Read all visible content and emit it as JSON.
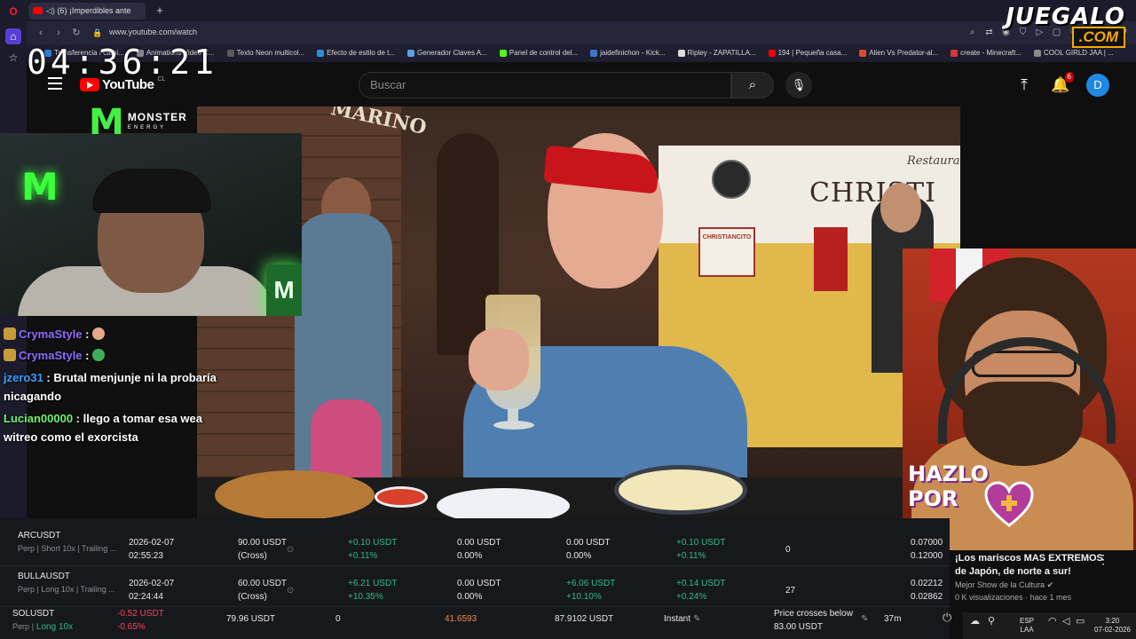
{
  "browser": {
    "tab_title": "(6) ¡Imperdibles ante",
    "url": "www.youtube.com/watch",
    "bookmarks": [
      {
        "label": "Transferencia / cami...",
        "color": "#2e7dd1"
      },
      {
        "label": "Animations Video C...",
        "color": "#888888"
      },
      {
        "label": "Texto Neon multicol...",
        "color": "#5a5a5a"
      },
      {
        "label": "Efecto de estilo de t...",
        "color": "#2b8fd6"
      },
      {
        "label": "Generador Claves A...",
        "color": "#5aa0e8"
      },
      {
        "label": "Panel de control del...",
        "color": "#53fc18"
      },
      {
        "label": "jaidefinichon - Kick...",
        "color": "#3a78d1"
      },
      {
        "label": "Ripley - ZAPATILLA...",
        "color": "#dddddd"
      },
      {
        "label": "194 | Pequeña casa...",
        "color": "#ff0000"
      },
      {
        "label": "Alien Vs Predator-al...",
        "color": "#e04b2a"
      },
      {
        "label": "create - Minecraft...",
        "color": "#d93636"
      },
      {
        "label": "COOL GIRLD JAA | ...",
        "color": "#8a8a8a"
      }
    ]
  },
  "overlay": {
    "clock": "04:36:21",
    "brand_top": "JUEGALO",
    "brand_bottom": ".COM",
    "monster_text": "MONSTER",
    "monster_sub": "ENERGY",
    "hazlo_line1": "HAZLO",
    "hazlo_line2": "POR"
  },
  "youtube": {
    "logo_text": "YouTube",
    "country": "CL",
    "search_placeholder": "Buscar",
    "notifications_count": "6",
    "avatar_letter": "D"
  },
  "video_scene": {
    "sign_marino": "MARINO",
    "sign_christ": "CHRISTI",
    "sign_restaurant": "Restaura",
    "sign_christiancito": "CHRISTIANCITO"
  },
  "chat": [
    {
      "user": "CrymaStyle",
      "message": ""
    },
    {
      "user": "CrymaStyle",
      "message": ""
    },
    {
      "user": "jzero31",
      "message": "Brutal menjunje ni la probaría",
      "message2": "nicagando"
    },
    {
      "user": "Lucian00000",
      "message": "llego a tomar esa wea",
      "message2": "witreo como el exorcista"
    }
  ],
  "trading": {
    "rows": [
      {
        "symbol": "ARCUSDT",
        "desc": "Perp | Short 10x | Trailing ...",
        "date": "2026-02-07",
        "time": "02:55:23",
        "margin": "90.00 USDT",
        "margin_mode": "(Cross)",
        "pnl_usdt": "+0.10 USDT",
        "pnl_pct": "+0.11%",
        "c1": "0.00 USDT",
        "c1b": "0.00%",
        "c2": "0.00 USDT",
        "c2b": "0.00%",
        "c3": "+0.10 USDT",
        "c3b": "+0.11%",
        "count": "0",
        "price1": "0.07000",
        "price2": "0.12000"
      },
      {
        "symbol": "BULLAUSDT",
        "desc": "Perp | Long 10x | Trailing ...",
        "date": "2026-02-07",
        "time": "02:24:44",
        "margin": "60.00 USDT",
        "margin_mode": "(Cross)",
        "pnl_usdt": "+6.21 USDT",
        "pnl_pct": "+10.35%",
        "c1": "0.00 USDT",
        "c1b": "0.00%",
        "c2": "+6.06 USDT",
        "c2b": "+10.10%",
        "c3": "+0.14 USDT",
        "c3b": "+0.24%",
        "count": "27",
        "price1": "0.02212",
        "price2": "0.02862"
      }
    ],
    "sol": {
      "symbol": "SOLUSDT",
      "desc_a": "Perp",
      "desc_b": "Long 10x",
      "pnl_usdt": "-0.52 USDT",
      "pnl_pct": "-0.65%",
      "margin": "79.96 USDT",
      "zero": "0",
      "price": "41.6593",
      "total": "87.9102 USDT",
      "mode": "Instant",
      "cond": "Price crosses below",
      "cond_val": "83.00 USDT",
      "ago": "37m"
    }
  },
  "suggestion": {
    "title": "¡Los mariscos MAS EXTREMOS de Japón, de norte a sur!",
    "channel": "Mejor Show de la Cultura",
    "views": "0 K visualizaciones · hace 1 mes"
  },
  "taskbar": {
    "lang1": "ESP",
    "lang2": "LAA",
    "time": "3:20",
    "date": "07-02-2026"
  }
}
